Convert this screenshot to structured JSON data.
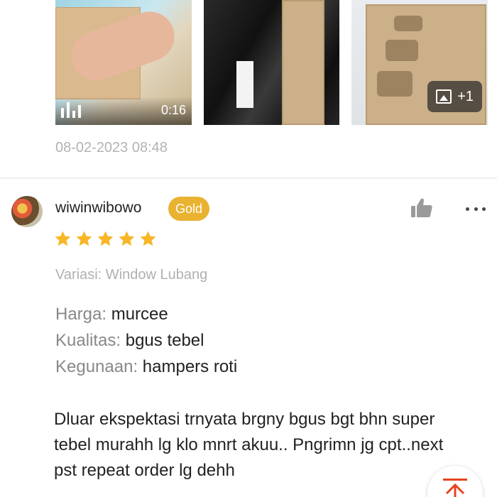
{
  "media": {
    "video_duration": "0:16",
    "more_count": "+1"
  },
  "previous_review": {
    "timestamp": "08-02-2023 08:48"
  },
  "review": {
    "username": "wiwinwibowo",
    "badge": "Gold",
    "rating": 5,
    "variant": "Variasi: Window Lubang",
    "attributes": [
      {
        "label": "Harga:",
        "value": " murcee"
      },
      {
        "label": "Kualitas:",
        "value": " bgus tebel"
      },
      {
        "label": "Kegunaan:",
        "value": " hampers roti"
      }
    ],
    "body": "Dluar ekspektasi trnyata brgny bgus bgt bhn super tebel murahh lg klo mnrt akuu.. Pngrimn jg cpt..next pst repeat order lg dehh"
  },
  "icons": {
    "video": "video-bars-icon",
    "image": "image-icon",
    "like": "thumbs-up-icon",
    "more": "more-dots-icon",
    "star": "star-icon",
    "scroll_top": "scroll-to-top-icon"
  },
  "colors": {
    "badge": "#e9b230",
    "star": "#f8b526",
    "accent": "#e8431f"
  }
}
